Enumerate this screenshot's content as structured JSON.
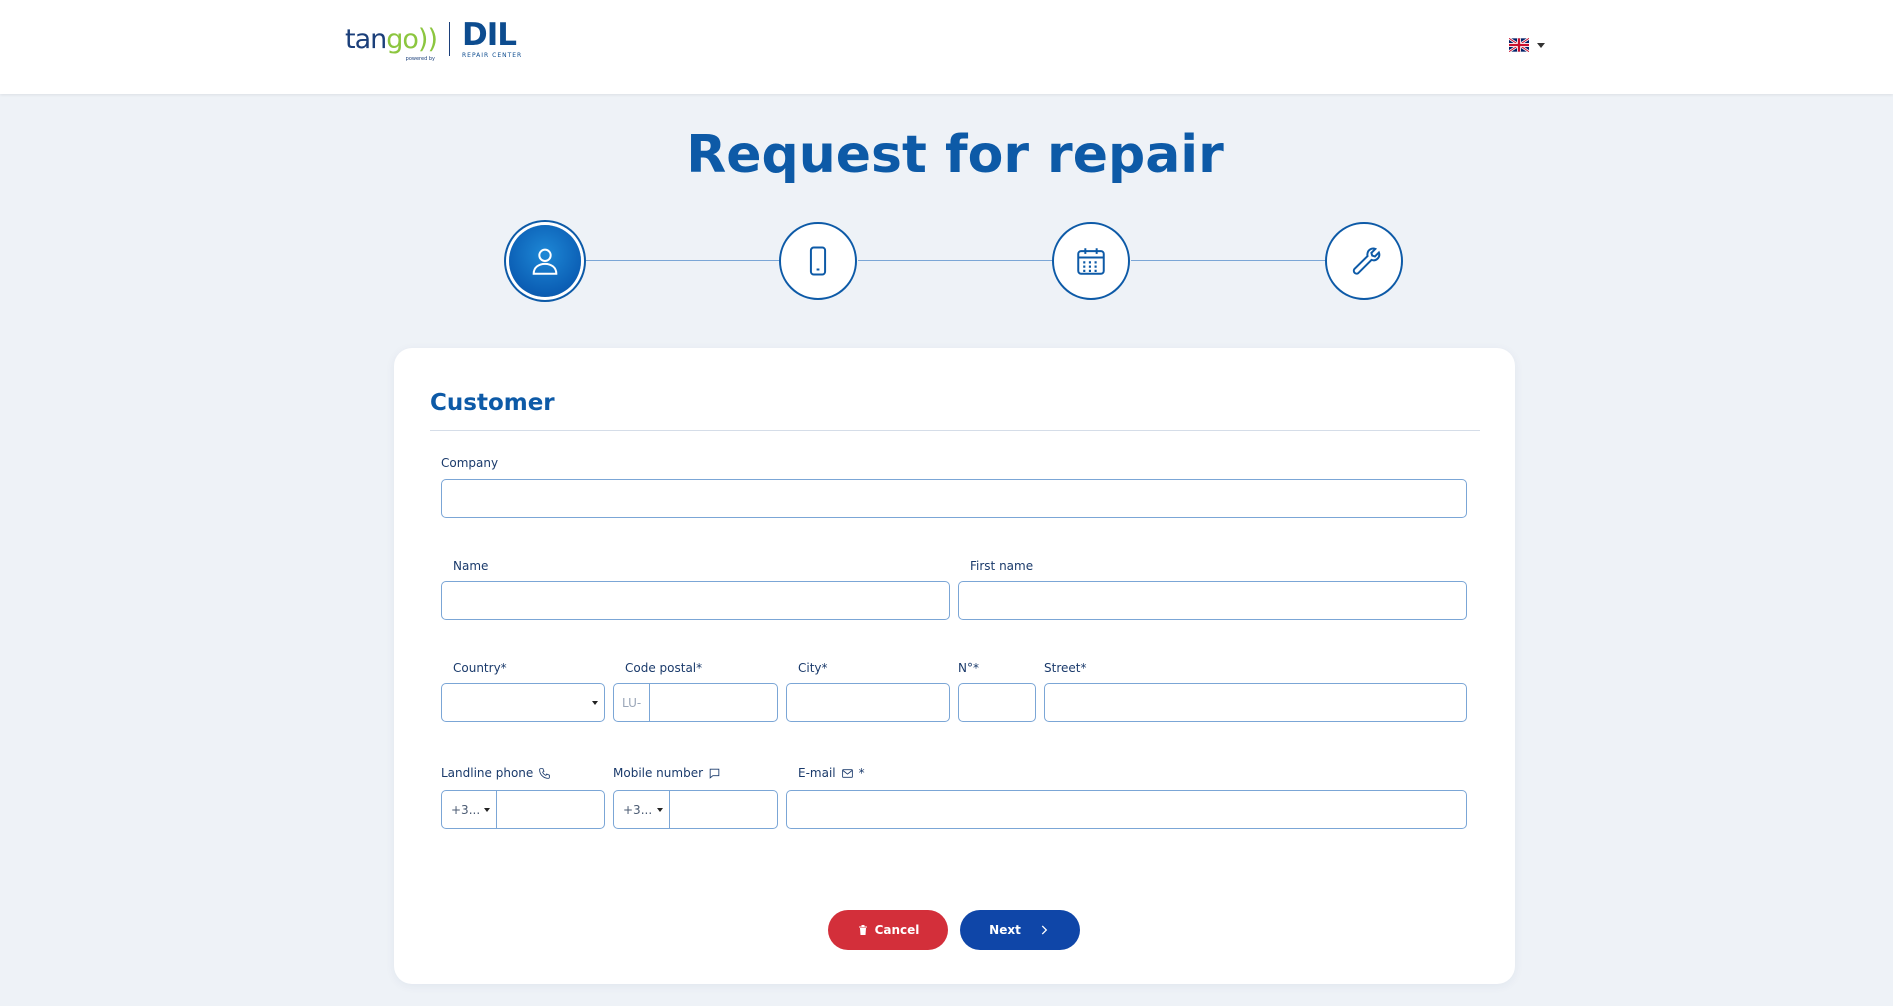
{
  "header": {
    "logo_tango_prefix": "tan",
    "logo_tango_suffix": "go))",
    "logo_powered": "powered by",
    "logo_dil": "DIL",
    "logo_repaircenter": "REPAIR CENTER",
    "language": "EN"
  },
  "page": {
    "title": "Request for repair"
  },
  "stepper": {
    "steps": [
      {
        "icon": "user-icon",
        "active": true
      },
      {
        "icon": "phone-icon",
        "active": false
      },
      {
        "icon": "calendar-icon",
        "active": false
      },
      {
        "icon": "wrench-icon",
        "active": false
      }
    ]
  },
  "form": {
    "section_title": "Customer",
    "company_label": "Company",
    "company_value": "",
    "name_label": "Name",
    "name_value": "",
    "first_name_label": "First name",
    "first_name_value": "",
    "country_label": "Country*",
    "country_value": "",
    "postal_label": "Code postal*",
    "postal_prefix": "LU-",
    "postal_value": "",
    "city_label": "City*",
    "city_value": "",
    "number_label": "N°*",
    "number_value": "",
    "street_label": "Street*",
    "street_value": "",
    "landline_label": "Landline phone",
    "landline_dial": "+3...",
    "landline_value": "",
    "mobile_label": "Mobile number",
    "mobile_dial": "+3...",
    "mobile_value": "",
    "email_label": "E-mail",
    "email_required": "*",
    "email_value": ""
  },
  "actions": {
    "cancel_label": "Cancel",
    "next_label": "Next"
  },
  "colors": {
    "primary": "#0d5aa7",
    "cancel": "#d32f3a",
    "next": "#0f46a8",
    "background": "#eef2f7"
  }
}
